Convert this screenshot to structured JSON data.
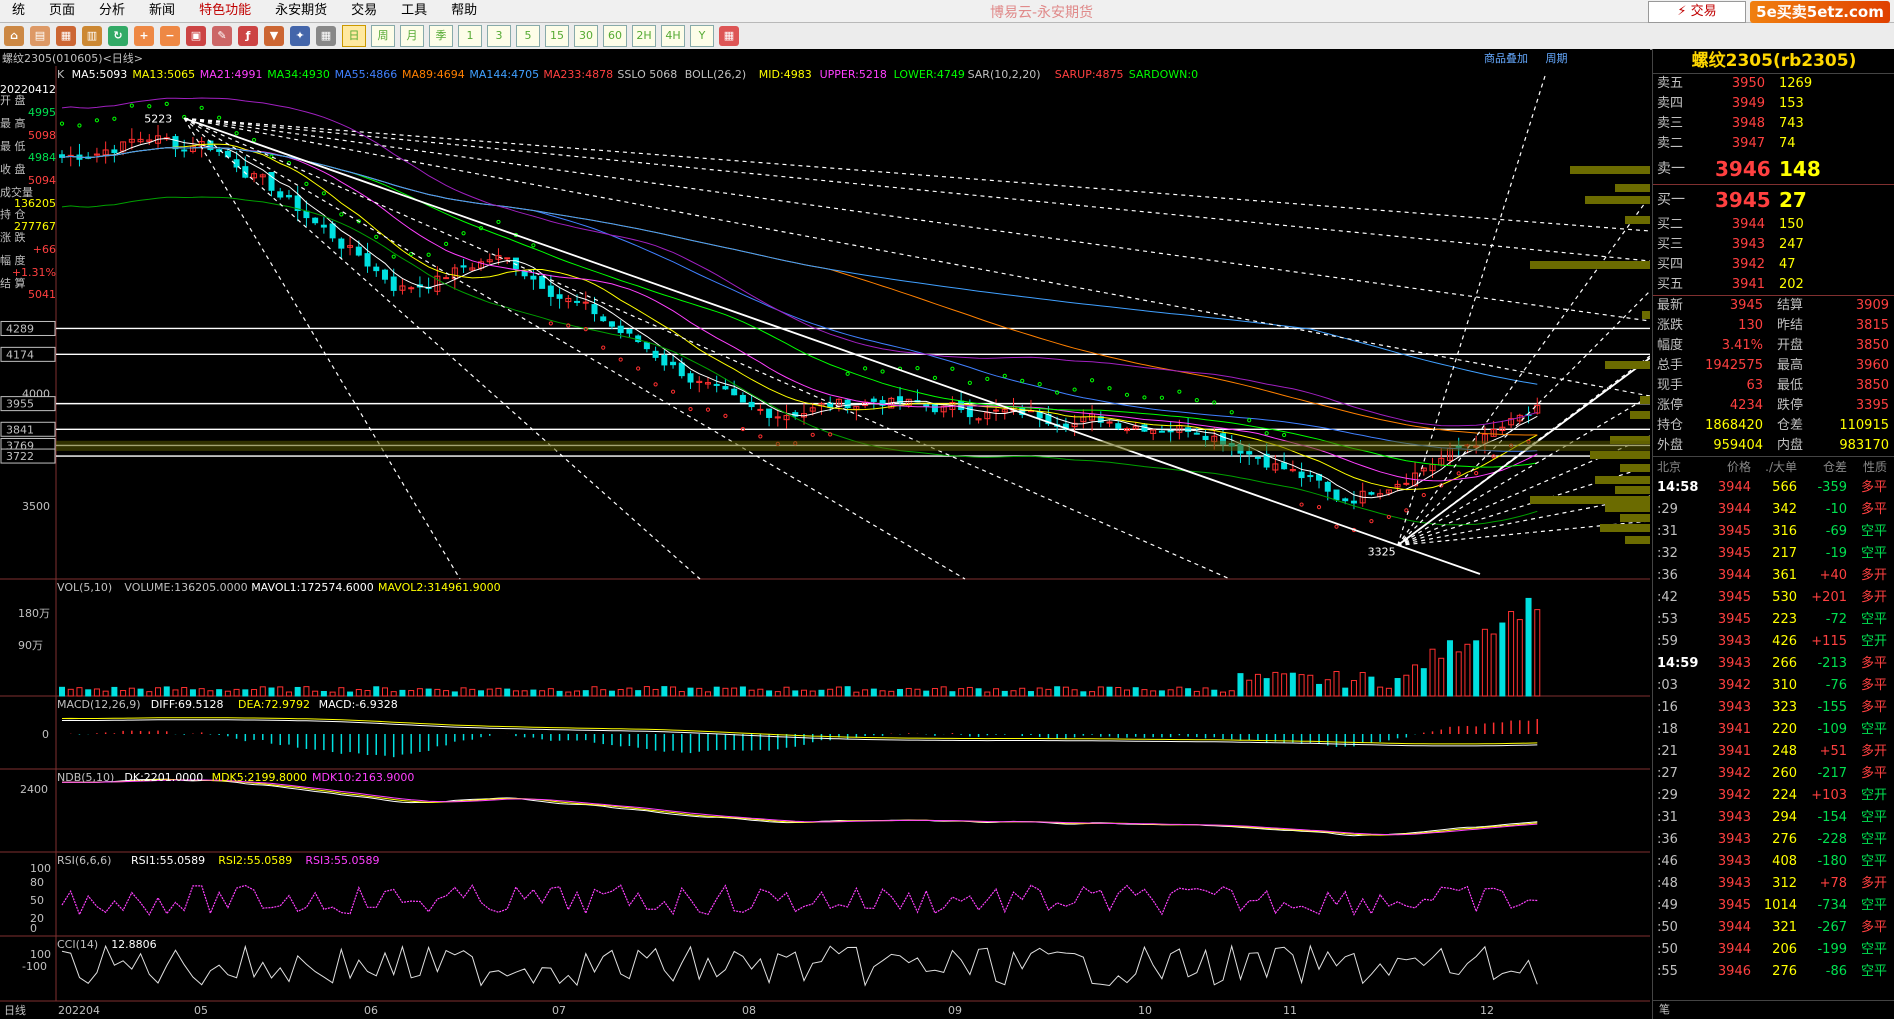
{
  "menu": {
    "items": [
      "统",
      "页面",
      "分析",
      "新闻",
      "特色功能",
      "永安期货",
      "交易",
      "工具",
      "帮助"
    ],
    "active_index": 4
  },
  "app_title": "博易云-永安期货",
  "trade_button": "交易",
  "watermark": "5e买卖5etz.com",
  "toolbar": {
    "periods": [
      "日",
      "周",
      "月",
      "季",
      "1",
      "3",
      "5",
      "15",
      "30",
      "60",
      "2H",
      "4H",
      "Y"
    ],
    "selected_period_index": 0
  },
  "chart": {
    "title": "螺纹2305(010605)<日线>",
    "links": [
      "商品叠加",
      "周期"
    ],
    "ma_line": [
      {
        "text": "K",
        "color": "#c0c0c0"
      },
      {
        "text": "MA5:5093",
        "color": "#ffffff"
      },
      {
        "text": "MA13:5065",
        "color": "#ffff00"
      },
      {
        "text": "MA21:4991",
        "color": "#ff40ff"
      },
      {
        "text": "MA34:4930",
        "color": "#00ff00"
      },
      {
        "text": "MA55:4866",
        "color": "#4080ff"
      },
      {
        "text": "MA89:4694",
        "color": "#ff8000"
      },
      {
        "text": "MA144:4705",
        "color": "#40a0ff"
      },
      {
        "text": "MA233:4878",
        "color": "#ff4040"
      },
      {
        "text": "SSLO 5068",
        "color": "#c0c0c0"
      },
      {
        "text": "BOLL(26,2)",
        "color": "#c0c0c0"
      },
      {
        "text": "MID:4983",
        "color": "#ffff00"
      },
      {
        "text": "UPPER:5218",
        "color": "#ff40ff"
      },
      {
        "text": "LOWER:4749",
        "color": "#00ff00"
      },
      {
        "text": "SAR(10,2,20)",
        "color": "#c0c0c0"
      },
      {
        "text": "SARUP:4875",
        "color": "#ff4040"
      },
      {
        "text": "SARDOWN:0",
        "color": "#00ff00"
      }
    ],
    "left_info": {
      "date": "20220412",
      "rows": [
        {
          "label": "开  盘",
          "value": "4995",
          "color": "#00e050"
        },
        {
          "label": "最  高",
          "value": "5098",
          "color": "#ff4040"
        },
        {
          "label": "最  低",
          "value": "4984",
          "color": "#00e050"
        },
        {
          "label": "收  盘",
          "value": "5094",
          "color": "#ff4040"
        },
        {
          "label": "成交量",
          "value": "136205",
          "color": "#ffff00"
        },
        {
          "label": "持  仓",
          "value": "277767",
          "color": "#ffff00"
        },
        {
          "label": "涨  跌",
          "value": "+66",
          "color": "#ff4040"
        },
        {
          "label": "幅  度",
          "value": "+1.31%",
          "color": "#ff4040"
        },
        {
          "label": "结  算",
          "value": "5041",
          "color": "#ff4040"
        }
      ]
    },
    "price_axis": [
      "4289",
      "4174",
      "4000",
      "3955",
      "3841",
      "3769",
      "3722",
      "3500"
    ],
    "annotations": {
      "high": "5223",
      "low": "3325"
    },
    "x_axis": [
      "日线",
      "202204",
      "05",
      "06",
      "07",
      "08",
      "09",
      "10",
      "11",
      "12"
    ]
  },
  "indicators": {
    "vol": {
      "segments": [
        {
          "text": "VOL(5,10)",
          "color": "#c0c0c0"
        },
        {
          "text": "VOLUME:136205.0000",
          "color": "#c0c0c0"
        },
        {
          "text": "MAVOL1:172574.6000",
          "color": "#ffffff"
        },
        {
          "text": "MAVOL2:314961.9000",
          "color": "#ffff00"
        }
      ],
      "axis": [
        "180万",
        "90万"
      ]
    },
    "macd": {
      "segments": [
        {
          "text": "MACD(12,26,9)",
          "color": "#c0c0c0"
        },
        {
          "text": "DIFF:69.5128",
          "color": "#ffffff"
        },
        {
          "text": "DEA:72.9792",
          "color": "#ffff00"
        },
        {
          "text": "MACD:-6.9328",
          "color": "#ffffff"
        }
      ],
      "axis": [
        "0"
      ]
    },
    "ndb": {
      "segments": [
        {
          "text": "NDB(5,10)",
          "color": "#c0c0c0"
        },
        {
          "text": "DK:2201.0000",
          "color": "#ffffff"
        },
        {
          "text": "MDK5:2199.8000",
          "color": "#ffff00"
        },
        {
          "text": "MDK10:2163.9000",
          "color": "#ff40ff"
        }
      ],
      "axis": [
        "2400"
      ]
    },
    "rsi": {
      "segments": [
        {
          "text": "RSI(6,6,6)",
          "color": "#c0c0c0"
        },
        {
          "text": "RSI1:55.0589",
          "color": "#ffffff"
        },
        {
          "text": "RSI2:55.0589",
          "color": "#ffff00"
        },
        {
          "text": "RSI3:55.0589",
          "color": "#ff40ff"
        }
      ],
      "axis": [
        "100",
        "80",
        "50",
        "20",
        "0"
      ]
    },
    "cci": {
      "segments": [
        {
          "text": "CCI(14)",
          "color": "#c0c0c0"
        },
        {
          "text": "12.8806",
          "color": "#ffffff"
        }
      ],
      "axis": [
        "100",
        "-100"
      ]
    }
  },
  "quote": {
    "title": "螺纹2305(rb2305)",
    "asks": [
      {
        "label": "卖五",
        "price": "3950",
        "qty": "1269"
      },
      {
        "label": "卖四",
        "price": "3949",
        "qty": "153"
      },
      {
        "label": "卖三",
        "price": "3948",
        "qty": "743"
      },
      {
        "label": "卖二",
        "price": "3947",
        "qty": "74"
      },
      {
        "label": "卖一",
        "price": "3946",
        "qty": "148"
      }
    ],
    "bids": [
      {
        "label": "买一",
        "price": "3945",
        "qty": "27"
      },
      {
        "label": "买二",
        "price": "3944",
        "qty": "150"
      },
      {
        "label": "买三",
        "price": "3943",
        "qty": "247"
      },
      {
        "label": "买四",
        "price": "3942",
        "qty": "47"
      },
      {
        "label": "买五",
        "price": "3941",
        "qty": "202"
      }
    ],
    "stats": [
      [
        "最新",
        "3945",
        "结算",
        "3909"
      ],
      [
        "涨跌",
        "130",
        "昨结",
        "3815"
      ],
      [
        "幅度",
        "3.41%",
        "开盘",
        "3850"
      ],
      [
        "总手",
        "1942575",
        "最高",
        "3960"
      ],
      [
        "现手",
        "63",
        "最低",
        "3850"
      ],
      [
        "涨停",
        "4234",
        "跌停",
        "3395"
      ],
      [
        "持仓",
        "1868420",
        "仓差",
        "110915"
      ],
      [
        "外盘",
        "959404",
        "内盘",
        "983170"
      ]
    ],
    "ticks_header": [
      "北京",
      "价格",
      "./大单",
      "仓差",
      "性质"
    ],
    "ticks": [
      {
        "time": "14:58",
        "price": "3944",
        "vol": "566",
        "diff": "-359",
        "type": "多平",
        "bold": true
      },
      {
        "time": ":29",
        "price": "3944",
        "vol": "342",
        "diff": "-10",
        "type": "多平"
      },
      {
        "time": ":31",
        "price": "3945",
        "vol": "316",
        "diff": "-69",
        "type": "空平"
      },
      {
        "time": ":32",
        "price": "3945",
        "vol": "217",
        "diff": "-19",
        "type": "空平"
      },
      {
        "time": ":36",
        "price": "3944",
        "vol": "361",
        "diff": "+40",
        "type": "多开"
      },
      {
        "time": ":42",
        "price": "3945",
        "vol": "530",
        "diff": "+201",
        "type": "多开"
      },
      {
        "time": ":53",
        "price": "3945",
        "vol": "223",
        "diff": "-72",
        "type": "空平"
      },
      {
        "time": ":59",
        "price": "3943",
        "vol": "426",
        "diff": "+115",
        "type": "空开"
      },
      {
        "time": "14:59",
        "price": "3943",
        "vol": "266",
        "diff": "-213",
        "type": "多平",
        "bold": true
      },
      {
        "time": ":03",
        "price": "3942",
        "vol": "310",
        "diff": "-76",
        "type": "多平"
      },
      {
        "time": ":16",
        "price": "3943",
        "vol": "323",
        "diff": "-155",
        "type": "多平"
      },
      {
        "time": ":18",
        "price": "3941",
        "vol": "220",
        "diff": "-109",
        "type": "空平"
      },
      {
        "time": ":21",
        "price": "3941",
        "vol": "248",
        "diff": "+51",
        "type": "多开"
      },
      {
        "time": ":27",
        "price": "3942",
        "vol": "260",
        "diff": "-217",
        "type": "多平"
      },
      {
        "time": ":29",
        "price": "3942",
        "vol": "224",
        "diff": "+103",
        "type": "空开"
      },
      {
        "time": ":31",
        "price": "3943",
        "vol": "294",
        "diff": "-154",
        "type": "空平"
      },
      {
        "time": ":36",
        "price": "3943",
        "vol": "276",
        "diff": "-228",
        "type": "空平"
      },
      {
        "time": ":46",
        "price": "3943",
        "vol": "408",
        "diff": "-180",
        "type": "空平"
      },
      {
        "time": ":48",
        "price": "3943",
        "vol": "312",
        "diff": "+78",
        "type": "多开"
      },
      {
        "time": ":49",
        "price": "3945",
        "vol": "1014",
        "diff": "-734",
        "type": "空平"
      },
      {
        "time": ":50",
        "price": "3944",
        "vol": "321",
        "diff": "-267",
        "type": "多平"
      },
      {
        "time": ":50",
        "price": "3944",
        "vol": "206",
        "diff": "-199",
        "type": "空平"
      },
      {
        "time": ":55",
        "price": "3946",
        "vol": "276",
        "diff": "-86",
        "type": "空平"
      }
    ],
    "bottom_label": "笔"
  }
}
